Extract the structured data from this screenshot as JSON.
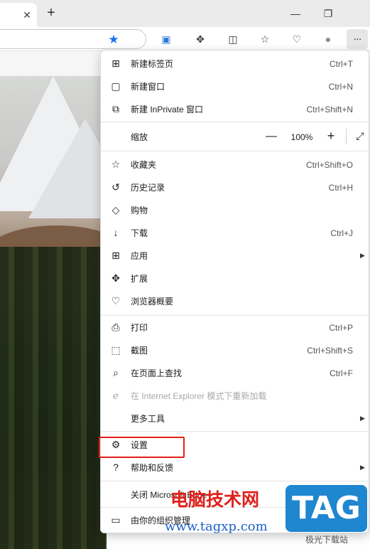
{
  "browser": {
    "tab_close": "✕",
    "new_tab": "+",
    "window_min": "—",
    "window_restore": "❐",
    "more_button": "···"
  },
  "menu": {
    "group1": [
      {
        "label": "新建标签页",
        "shortcut": "Ctrl+T",
        "icon": "new-tab-icon"
      },
      {
        "label": "新建窗口",
        "shortcut": "Ctrl+N",
        "icon": "new-window-icon"
      },
      {
        "label": "新建 InPrivate 窗口",
        "shortcut": "Ctrl+Shift+N",
        "icon": "inprivate-window-icon"
      }
    ],
    "zoom": {
      "label": "缩放",
      "value": "100%",
      "minus": "—",
      "plus": "+",
      "fullscreen": "⤢"
    },
    "group2": [
      {
        "label": "收藏夹",
        "shortcut": "Ctrl+Shift+O",
        "icon": "favorites-icon"
      },
      {
        "label": "历史记录",
        "shortcut": "Ctrl+H",
        "icon": "history-icon"
      },
      {
        "label": "购物",
        "shortcut": "",
        "icon": "shopping-tag-icon"
      },
      {
        "label": "下载",
        "shortcut": "Ctrl+J",
        "icon": "download-icon"
      },
      {
        "label": "应用",
        "shortcut": "",
        "icon": "apps-icon",
        "submenu": true
      },
      {
        "label": "扩展",
        "shortcut": "",
        "icon": "extensions-icon"
      },
      {
        "label": "浏览器概要",
        "shortcut": "",
        "icon": "browser-essentials-icon"
      }
    ],
    "group3": [
      {
        "label": "打印",
        "shortcut": "Ctrl+P",
        "icon": "print-icon"
      },
      {
        "label": "截图",
        "shortcut": "Ctrl+Shift+S",
        "icon": "screenshot-icon"
      },
      {
        "label": "在页面上查找",
        "shortcut": "Ctrl+F",
        "icon": "find-on-page-icon"
      },
      {
        "label": "在 Internet Explorer 模式下重新加载",
        "shortcut": "",
        "icon": "ie-mode-icon",
        "disabled": true
      },
      {
        "label": "更多工具",
        "shortcut": "",
        "icon": "",
        "submenu": true
      }
    ],
    "group4": [
      {
        "label": "设置",
        "icon": "settings-gear-icon"
      },
      {
        "label": "帮助和反馈",
        "icon": "help-icon",
        "submenu": true
      }
    ],
    "close_label": "关闭 Microsoft Edge",
    "managed_label": "由你的组织管理"
  },
  "watermark": {
    "title": "电脑技术网",
    "url": "www.tagxp.com",
    "tag": "TAG",
    "site": "极光下载站"
  },
  "colors": {
    "accent_star": "#1a73e8",
    "highlight_box": "#e0201b",
    "watermark_blue": "#1f86d0"
  }
}
